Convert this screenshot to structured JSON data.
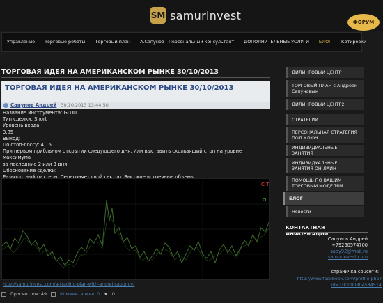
{
  "header": {
    "logo_mark": "SM",
    "logo_text": "samurinvest",
    "forum_label": "ФОРУМ"
  },
  "nav": {
    "items": [
      {
        "label": "Управление"
      },
      {
        "label": "Торговые роботы"
      },
      {
        "label": "Торговый план"
      },
      {
        "label": "А.Сапунов - Персональный консультант"
      },
      {
        "label": "ДОПОЛНИТЕЛЬНЫЕ УСЛУГИ"
      },
      {
        "label": "БЛОГ"
      },
      {
        "label": "Котировки"
      }
    ]
  },
  "main": {
    "page_title": "ТОРГОВАЯ ИДЕЯ НА АМЕРИКАНСКОМ РЫНКЕ 30/10/2013",
    "article_title": "ТОРГОВАЯ ИДЕЯ НА АМЕРИКАНСКОМ РЫНКЕ 30/10/2013",
    "author": "Сапунов Андрей",
    "date": "30.10.2013 13:44:50",
    "lines": [
      "Название инструмента: GLUU",
      "Тип сделки: Short",
      "Уровень входа:",
      "3.85",
      "Выход:",
      "По стоп-лоссу: 4.16",
      "При первом прибльном открытии следующего дня. Или выставить скользящий стоп на уровне максимума",
      "за последние 2 или 3 дня",
      "Обоснование сделки:",
      "Разворотный паттерн. Перегоняет свой сектор. Высокие встречные объемы"
    ],
    "chart_mark_top": "C T",
    "chart_mark_second": "G",
    "footer_link": "http://samurinvest.com/a-trading-plan-with-andrei-sapunov/",
    "views": "Просмотров: 49",
    "comments": "Комментариев: 0",
    "rating": "0"
  },
  "sidebar": {
    "items": [
      {
        "label": "ДИЛИНГОВЫЙ ЦЕНТР"
      },
      {
        "label": "ТОРГОВЫЙ ПЛАН с Андреем Сапуновым"
      },
      {
        "label": "ДИЛИНГОВЫЙ ЦЕНТР2"
      },
      {
        "label": "СТРАТЕГИИ"
      },
      {
        "label": "ПЕРСОНАЛЬНАЯ СТРАТЕГИЯ ПОД КЛЮЧ"
      },
      {
        "label": "ИНДИВИДУАЛЬНЫЕ ЗАНЯТИЯ"
      },
      {
        "label": "ИНДИВИДУАЛЬНЫЕ ЗАНЯТИЯ ОН-ЛАЙН"
      },
      {
        "label": "ПОМОЩЬ ПО ВАШИМ ТОРГОВЫМ МОДЕЛЯМ"
      },
      {
        "label": "БЛОГ"
      },
      {
        "label": "Новости"
      }
    ],
    "contact_heading": "КОНТАКТНАЯ ИНФОРМАЦИЯ",
    "contact_name": "Сапунов Андрей",
    "contact_phone": "+79260574700",
    "contact_email": "saby92@mail.ru",
    "contact_site": "samurinvest.com",
    "social_label": "страничка соцсети:",
    "social_link_1": "http://www.facebook.com/profile.php?",
    "social_link_2": "id=100000804584514"
  },
  "colors": {
    "accent": "#e6b84a",
    "link": "#4a7fb3",
    "title_blue": "#2d4a86",
    "chart_line": "#3f6b2e"
  }
}
